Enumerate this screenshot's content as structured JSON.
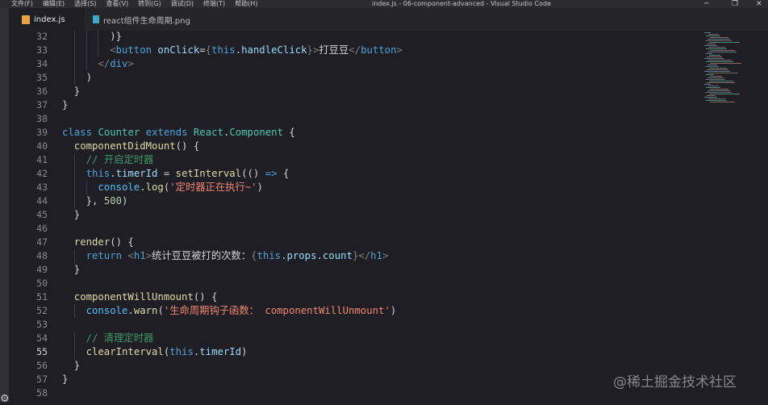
{
  "menu": [
    "文件(F)",
    "编辑(E)",
    "选择(S)",
    "查看(V)",
    "转到(G)",
    "调试(D)",
    "终端(T)",
    "帮助(H)"
  ],
  "window_title": "index.js - 06-component-advanced - Visual Studio Code",
  "tabs": [
    {
      "label": "index.js",
      "active": true
    },
    {
      "label": "react组件生命周期.png",
      "active": false
    }
  ],
  "watermark": "@稀土掘金技术社区",
  "colors": {
    "keyword": "#4fa3d8",
    "class_name": "#4ec9b0",
    "function": "#dcdcaa",
    "string": "#f48771",
    "comment": "#3e9a6a",
    "variable": "#4fc1ff",
    "jsx_tag": "#808080",
    "jsx_attr": "#9cdcfe",
    "number": "#b5cea8",
    "plain": "#d4d4d4"
  },
  "code_lines": [
    {
      "n": 32,
      "indent": 4,
      "tokens": [
        [
          "plain",
          ")}"
        ]
      ]
    },
    {
      "n": 33,
      "indent": 4,
      "tokens": [
        [
          "jsx_tag",
          "<"
        ],
        [
          "keyword",
          "button"
        ],
        [
          "plain",
          " "
        ],
        [
          "jsx_attr",
          "onClick"
        ],
        [
          "plain",
          "="
        ],
        [
          "jsx_tag",
          "{"
        ],
        [
          "keyword",
          "this"
        ],
        [
          "plain",
          "."
        ],
        [
          "jsx_attr",
          "handleClick"
        ],
        [
          "jsx_tag",
          "}"
        ],
        [
          "jsx_tag",
          ">"
        ],
        [
          "plain",
          "打豆豆"
        ],
        [
          "jsx_tag",
          "</"
        ],
        [
          "keyword",
          "button"
        ],
        [
          "jsx_tag",
          ">"
        ]
      ]
    },
    {
      "n": 34,
      "indent": 3,
      "tokens": [
        [
          "jsx_tag",
          "</"
        ],
        [
          "keyword",
          "div"
        ],
        [
          "jsx_tag",
          ">"
        ]
      ]
    },
    {
      "n": 35,
      "indent": 2,
      "tokens": [
        [
          "plain",
          ")"
        ]
      ]
    },
    {
      "n": 36,
      "indent": 1,
      "tokens": [
        [
          "plain",
          "}"
        ]
      ]
    },
    {
      "n": 37,
      "indent": 0,
      "tokens": [
        [
          "plain",
          "}"
        ]
      ]
    },
    {
      "n": 38,
      "indent": 0,
      "tokens": []
    },
    {
      "n": 39,
      "indent": 0,
      "tokens": [
        [
          "keyword",
          "class"
        ],
        [
          "plain",
          " "
        ],
        [
          "class_name",
          "Counter"
        ],
        [
          "plain",
          " "
        ],
        [
          "keyword",
          "extends"
        ],
        [
          "plain",
          " "
        ],
        [
          "class_name",
          "React"
        ],
        [
          "plain",
          "."
        ],
        [
          "class_name",
          "Component"
        ],
        [
          "plain",
          " {"
        ]
      ]
    },
    {
      "n": 40,
      "indent": 1,
      "tokens": [
        [
          "function",
          "componentDidMount"
        ],
        [
          "plain",
          "() {"
        ]
      ]
    },
    {
      "n": 41,
      "indent": 2,
      "tokens": [
        [
          "comment",
          "// 开启定时器"
        ]
      ]
    },
    {
      "n": 42,
      "indent": 2,
      "tokens": [
        [
          "keyword",
          "this"
        ],
        [
          "plain",
          "."
        ],
        [
          "jsx_attr",
          "timerId"
        ],
        [
          "plain",
          " = "
        ],
        [
          "function",
          "setInterval"
        ],
        [
          "plain",
          "(() "
        ],
        [
          "keyword",
          "=>"
        ],
        [
          "plain",
          " {"
        ]
      ]
    },
    {
      "n": 43,
      "indent": 3,
      "tokens": [
        [
          "variable",
          "console"
        ],
        [
          "plain",
          "."
        ],
        [
          "function",
          "log"
        ],
        [
          "plain",
          "("
        ],
        [
          "string",
          "'定时器正在执行~'"
        ],
        [
          "plain",
          ")"
        ]
      ]
    },
    {
      "n": 44,
      "indent": 2,
      "tokens": [
        [
          "plain",
          "}, "
        ],
        [
          "number",
          "500"
        ],
        [
          "plain",
          ")"
        ]
      ]
    },
    {
      "n": 45,
      "indent": 1,
      "tokens": [
        [
          "plain",
          "}"
        ]
      ]
    },
    {
      "n": 46,
      "indent": 0,
      "tokens": []
    },
    {
      "n": 47,
      "indent": 1,
      "tokens": [
        [
          "function",
          "render"
        ],
        [
          "plain",
          "() {"
        ]
      ]
    },
    {
      "n": 48,
      "indent": 2,
      "tokens": [
        [
          "keyword",
          "return"
        ],
        [
          "plain",
          " "
        ],
        [
          "jsx_tag",
          "<"
        ],
        [
          "keyword",
          "h1"
        ],
        [
          "jsx_tag",
          ">"
        ],
        [
          "plain",
          "统计豆豆被打的次数："
        ],
        [
          "jsx_tag",
          "{"
        ],
        [
          "keyword",
          "this"
        ],
        [
          "plain",
          "."
        ],
        [
          "jsx_attr",
          "props"
        ],
        [
          "plain",
          "."
        ],
        [
          "jsx_attr",
          "count"
        ],
        [
          "jsx_tag",
          "}"
        ],
        [
          "jsx_tag",
          "</"
        ],
        [
          "keyword",
          "h1"
        ],
        [
          "jsx_tag",
          ">"
        ]
      ]
    },
    {
      "n": 49,
      "indent": 1,
      "tokens": [
        [
          "plain",
          "}"
        ]
      ]
    },
    {
      "n": 50,
      "indent": 0,
      "tokens": []
    },
    {
      "n": 51,
      "indent": 1,
      "tokens": [
        [
          "function",
          "componentWillUnmount"
        ],
        [
          "plain",
          "() {"
        ]
      ]
    },
    {
      "n": 52,
      "indent": 2,
      "tokens": [
        [
          "variable",
          "console"
        ],
        [
          "plain",
          "."
        ],
        [
          "function",
          "warn"
        ],
        [
          "plain",
          "("
        ],
        [
          "string",
          "'生命周期钩子函数： componentWillUnmount'"
        ],
        [
          "plain",
          ")"
        ]
      ]
    },
    {
      "n": 53,
      "indent": 0,
      "tokens": []
    },
    {
      "n": 54,
      "indent": 2,
      "tokens": [
        [
          "comment",
          "// 清理定时器"
        ]
      ]
    },
    {
      "n": 55,
      "indent": 2,
      "tokens": [
        [
          "function",
          "clearInterval"
        ],
        [
          "plain",
          "("
        ],
        [
          "keyword",
          "this"
        ],
        [
          "plain",
          "."
        ],
        [
          "jsx_attr",
          "timerId"
        ],
        [
          "plain",
          ")"
        ]
      ]
    },
    {
      "n": 56,
      "indent": 1,
      "tokens": [
        [
          "plain",
          "}"
        ]
      ]
    },
    {
      "n": 57,
      "indent": 0,
      "tokens": [
        [
          "plain",
          "}"
        ]
      ]
    },
    {
      "n": 58,
      "indent": 0,
      "tokens": []
    }
  ],
  "current_line": 55
}
